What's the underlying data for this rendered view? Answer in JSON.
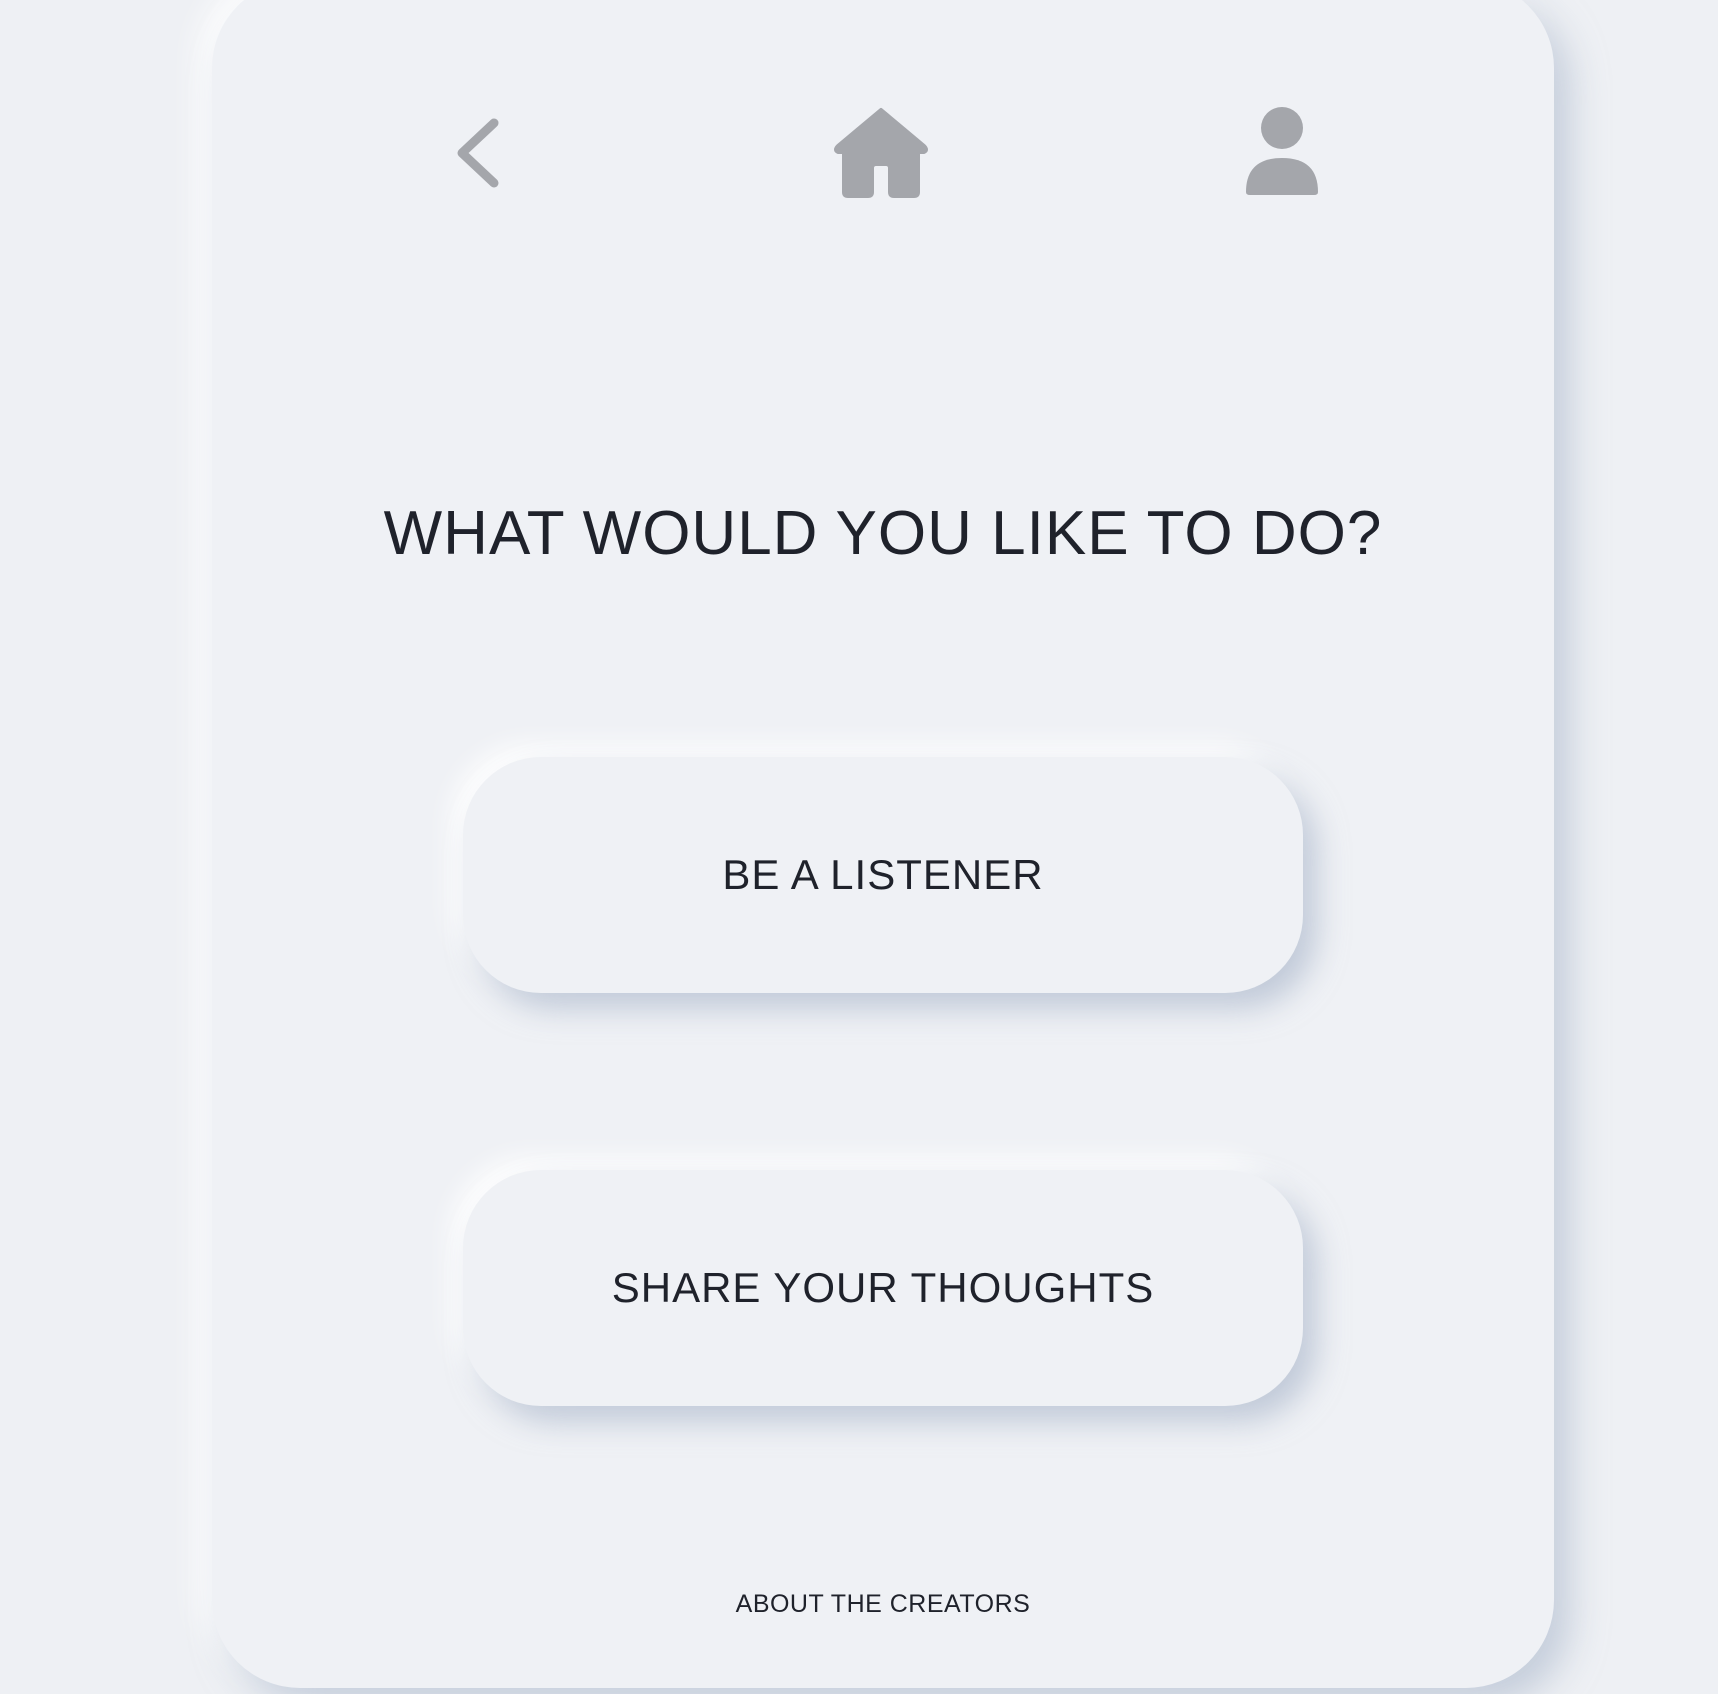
{
  "nav": {
    "back_icon": "chevron-left-icon",
    "home_icon": "house-icon",
    "profile_icon": "user-icon",
    "icon_color": "#a4a6ab"
  },
  "main": {
    "title": "WHAT WOULD YOU LIKE TO DO?",
    "buttons": [
      {
        "label": "BE A LISTENER"
      },
      {
        "label": "SHARE YOUR THOUGHTS"
      }
    ]
  },
  "footer": {
    "link_label": "ABOUT THE CREATORS"
  },
  "colors": {
    "background": "#eef0f4",
    "text": "#1f222b"
  }
}
